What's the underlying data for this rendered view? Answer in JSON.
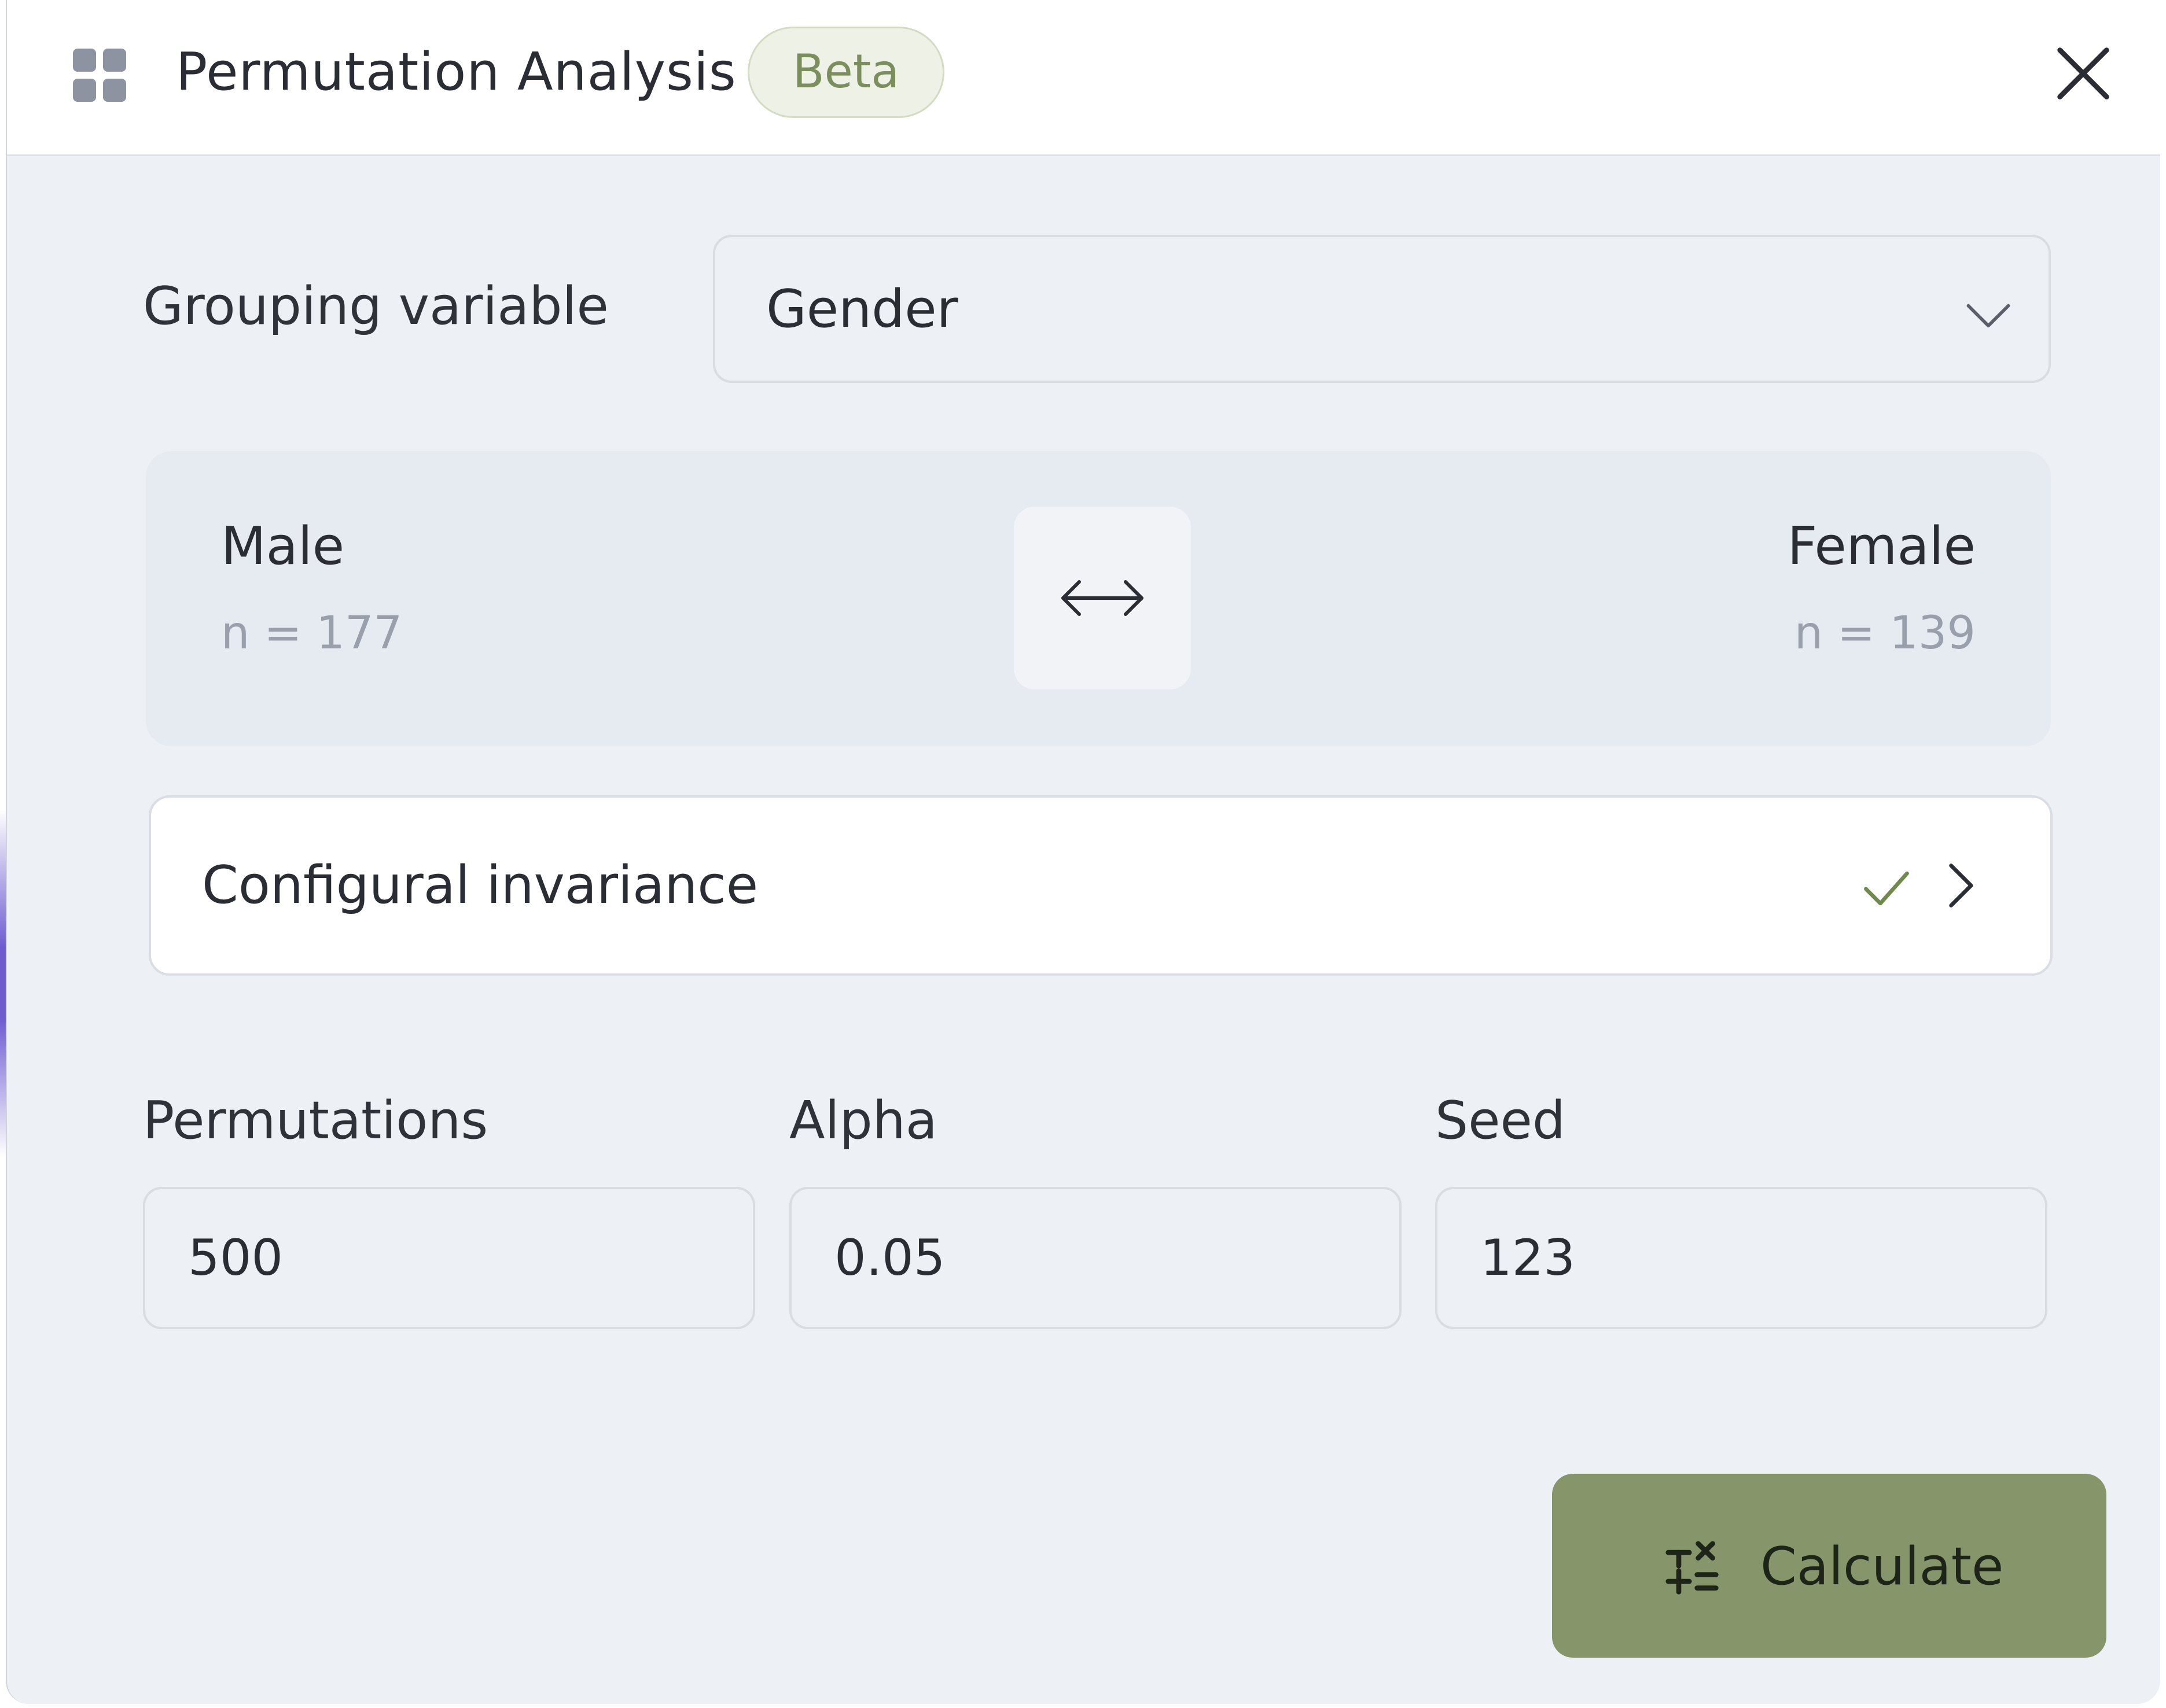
{
  "header": {
    "title": "Permutation Analysis",
    "badge": "Beta",
    "app_icon": "grid-icon",
    "close_icon": "close-icon"
  },
  "grouping": {
    "label": "Grouping variable",
    "selected": "Gender",
    "icon": "chevron-down-icon"
  },
  "groups": {
    "left": {
      "name": "Male",
      "n": "n = 177"
    },
    "right": {
      "name": "Female",
      "n": "n = 139"
    },
    "swap_icon": "swap-arrows-icon"
  },
  "invariance": {
    "label": "Configural invariance",
    "status_icon": "check-icon",
    "status_color": "#6f8a4a",
    "nav_icon": "chevron-right-icon"
  },
  "params": {
    "permutations": {
      "label": "Permutations",
      "value": "500"
    },
    "alpha": {
      "label": "Alpha",
      "value": "0.05"
    },
    "seed": {
      "label": "Seed",
      "value": "123"
    }
  },
  "actions": {
    "calculate_label": "Calculate",
    "calculate_icon": "calculator-icon",
    "calculate_color": "#86966a"
  }
}
